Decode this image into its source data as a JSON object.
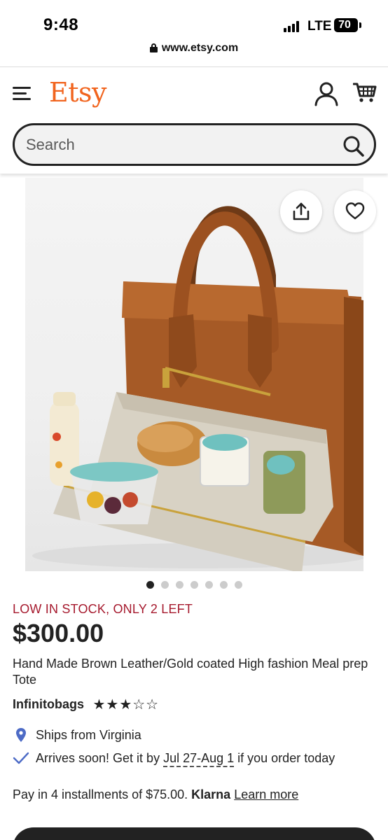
{
  "status_bar": {
    "time": "9:48",
    "network": "LTE",
    "battery": "70"
  },
  "browser": {
    "url": "www.etsy.com"
  },
  "header": {
    "logo": "Etsy",
    "search_placeholder": "Search",
    "brand_color": "#F1641E"
  },
  "gallery": {
    "image_description_icon": "product-photo",
    "dots_count": 7,
    "active_dot": 0
  },
  "product": {
    "stock_notice": "LOW IN STOCK, ONLY 2 LEFT",
    "price": "$300.00",
    "title": "Hand Made Brown Leather/Gold coated High fashion Meal prep Tote",
    "shop_name": "Infinitobags",
    "rating_stars": 3,
    "rating_max": 5,
    "stars_text": "★★★☆☆",
    "ships_from": "Ships from Virginia",
    "arrives_prefix": "Arrives soon! Get it by ",
    "arrives_dates": "Jul 27-Aug 1",
    "arrives_suffix": " if you order today",
    "pay_text": "Pay in 4 installments of $75.00. ",
    "pay_provider": "Klarna",
    "learn_more": "Learn more",
    "stock_color": "#A61A2E"
  }
}
